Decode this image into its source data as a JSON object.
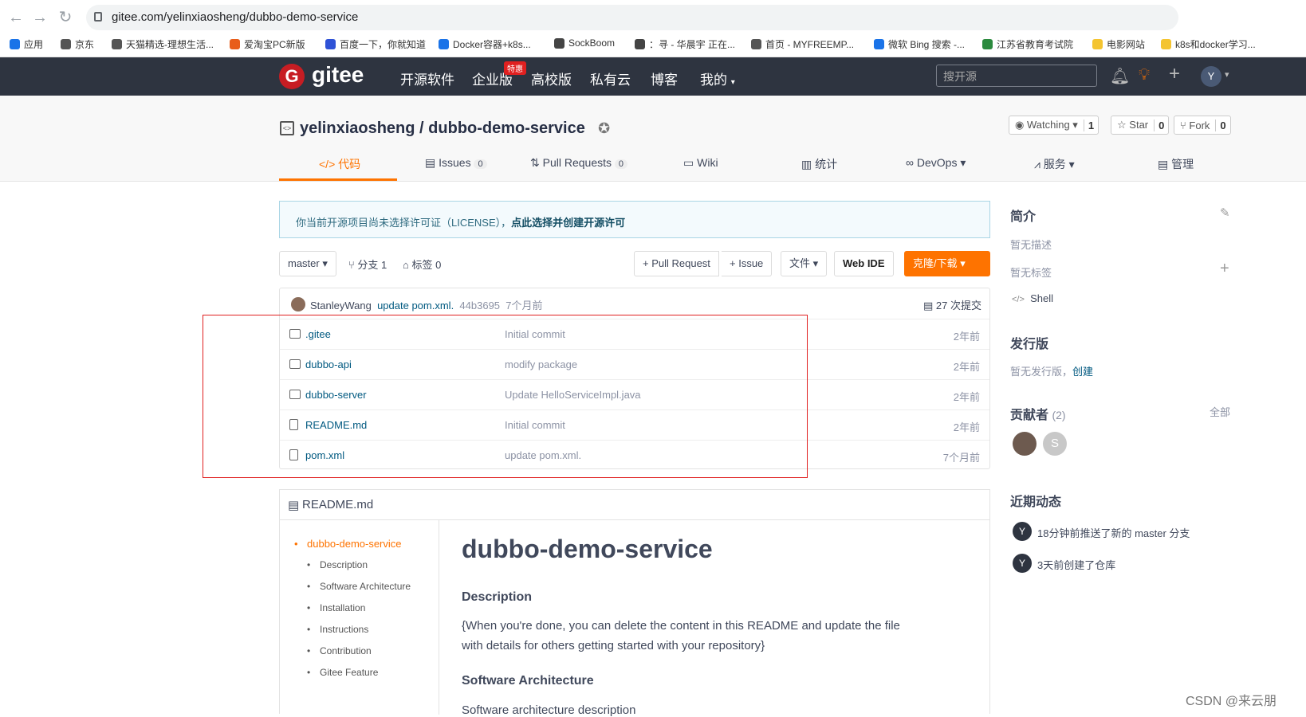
{
  "browser": {
    "url": "gitee.com/yelinxiaosheng/dubbo-demo-service",
    "bookmarks": [
      "应用",
      "京东",
      "天猫精选-理想生活...",
      "爱淘宝PC新版",
      "百度一下，你就知道",
      "Docker容器+k8s...",
      "SockBoom",
      "：寻 - 华晨宇 正在...",
      "首页 - MYFREEMP...",
      "微软 Bing 搜索 -...",
      "江苏省教育考试院",
      "电影网站",
      "k8s和docker学习..."
    ]
  },
  "header": {
    "logo_text": "gitee",
    "nav": [
      "开源软件",
      "企业版",
      "高校版",
      "私有云",
      "博客",
      "我的"
    ],
    "badge": "特惠",
    "search_placeholder": "搜开源",
    "avatar_letter": "Y"
  },
  "repo": {
    "title": "yelinxiaosheng / dubbo-demo-service",
    "watch_label": "Watching",
    "watch_count": "1",
    "star_label": "Star",
    "star_count": "0",
    "fork_label": "Fork",
    "fork_count": "0",
    "tabs": [
      {
        "label": "代码"
      },
      {
        "label": "Issues",
        "count": "0"
      },
      {
        "label": "Pull Requests",
        "count": "0"
      },
      {
        "label": "Wiki"
      },
      {
        "label": "统计"
      },
      {
        "label": "DevOps"
      },
      {
        "label": "服务"
      },
      {
        "label": "管理"
      }
    ]
  },
  "license": {
    "text": "你当前开源项目尚未选择许可证（LICENSE），",
    "link": "点此选择并创建开源许可"
  },
  "toolbar": {
    "branch": "master",
    "branches": "分支 1",
    "tags": "标签 0",
    "pull_request": "+ Pull Request",
    "issue": "+ Issue",
    "file": "文件",
    "web_ide": "Web IDE",
    "clone": "克隆/下载"
  },
  "commit": {
    "author": "StanleyWang",
    "message": "update pom.xml.",
    "hash": "44b3695",
    "time": "7个月前",
    "count": "27 次提交"
  },
  "files": [
    {
      "name": ".gitee",
      "type": "folder",
      "message": "Initial commit",
      "time": "2年前"
    },
    {
      "name": "dubbo-api",
      "type": "folder",
      "message": "modify package",
      "time": "2年前"
    },
    {
      "name": "dubbo-server",
      "type": "folder",
      "message": "Update HelloServiceImpl.java",
      "time": "2年前"
    },
    {
      "name": "README.md",
      "type": "file",
      "message": "Initial commit",
      "time": "2年前"
    },
    {
      "name": "pom.xml",
      "type": "file",
      "message": "update pom.xml.",
      "time": "7个月前"
    }
  ],
  "readme": {
    "filename": "README.md",
    "toc": [
      "dubbo-demo-service",
      "Description",
      "Software Architecture",
      "Installation",
      "Instructions",
      "Contribution",
      "Gitee Feature"
    ],
    "h1": "dubbo-demo-service",
    "h_description": "Description",
    "p_description_1": "{When you're done, you can delete the content in this README and update the file",
    "p_description_2": "with details for others getting started with your repository}",
    "h_arch": "Software Architecture",
    "p_arch": "Software architecture description"
  },
  "sidebar": {
    "intro_title": "简介",
    "no_desc": "暂无描述",
    "no_tags": "暂无标签",
    "language": "Shell",
    "release_title": "发行版",
    "no_release": "暂无发行版，",
    "create": "创建",
    "contrib_title": "贡献者",
    "contrib_count": "(2)",
    "all": "全部",
    "contrib_s": "S",
    "activity_title": "近期动态",
    "activities": [
      "18分钟前推送了新的 master 分支",
      "3天前创建了仓库"
    ]
  },
  "watermark": "CSDN @来云朋"
}
